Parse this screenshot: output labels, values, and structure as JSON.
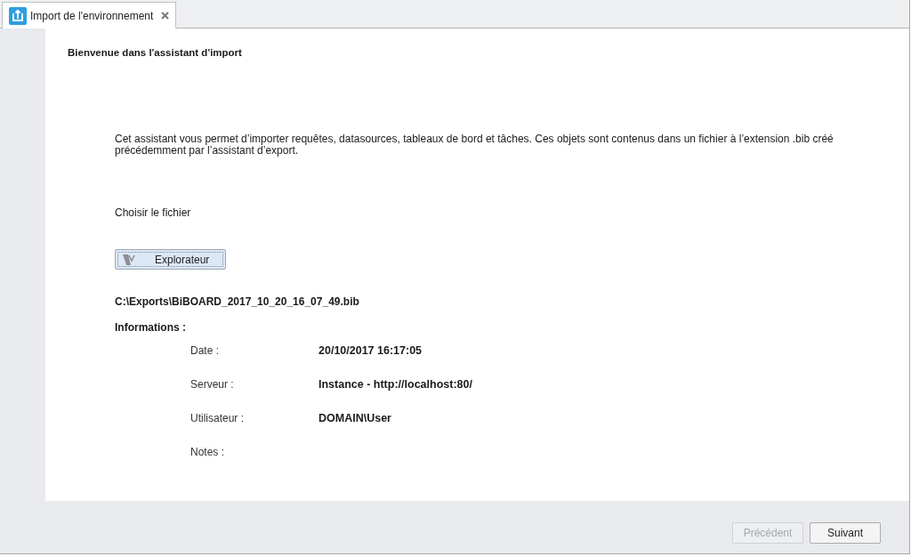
{
  "tabs": [
    {
      "title": "Import de l'environnement",
      "selected": true
    }
  ],
  "wizard": {
    "heading": "Bienvenue dans l'assistant d'import",
    "description": "Cet assistant vous permet d’importer requêtes, datasources, tableaux de bord et tâches. Ces objets sont contenus dans un fichier à l’extension .bib créé précédemment par l’assistant d’export.",
    "file_label": "Choisir le fichier",
    "browse_button": "Explorateur",
    "file_path": "C:\\Exports\\BiBOARD_2017_10_20_16_07_49.bib",
    "info_heading": "Informations :",
    "info": [
      {
        "label": "Date :",
        "value": "20/10/2017 16:17:05"
      },
      {
        "label": "Serveur :",
        "value": "Instance - http://localhost:80/"
      },
      {
        "label": "Utilisateur :",
        "value": "DOMAIN\\User"
      },
      {
        "label": "Notes :"
      }
    ]
  },
  "buttons": [
    {
      "label": "Précédent",
      "disabled": true
    },
    {
      "label": "Suivant",
      "disabled": false
    }
  ]
}
